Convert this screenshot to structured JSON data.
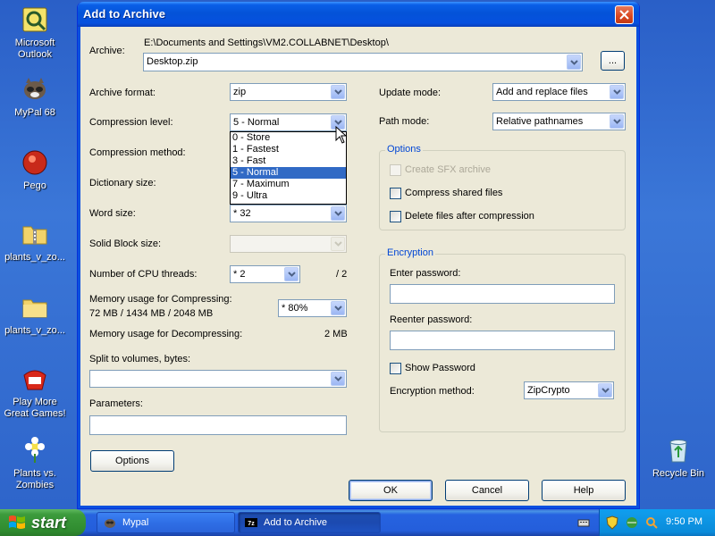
{
  "desktop": {
    "icons": [
      {
        "label": "Microsoft Outlook"
      },
      {
        "label": "MyPal 68"
      },
      {
        "label": "Pego"
      },
      {
        "label": "plants_v_zo..."
      },
      {
        "label": "plants_v_zo..."
      },
      {
        "label": "Play More Great Games!"
      },
      {
        "label": "Plants vs. Zombies"
      },
      {
        "label": "Recycle Bin"
      }
    ]
  },
  "window": {
    "title": "Add to Archive"
  },
  "archive": {
    "label": "Archive:",
    "path": "E:\\Documents and Settings\\VM2.COLLABNET\\Desktop\\",
    "name": "Desktop.zip",
    "browse_label": "..."
  },
  "left": {
    "format_label": "Archive format:",
    "format_value": "zip",
    "level_label": "Compression level:",
    "level_value": "5 - Normal",
    "method_label": "Compression method:",
    "dict_label": "Dictionary size:",
    "word_label": "Word size:",
    "word_value": "* 32",
    "solid_label": "Solid Block size:",
    "threads_label": "Number of CPU threads:",
    "threads_value": "* 2",
    "threads_total": "/ 2",
    "mem_comp_label": "Memory usage for Compressing:",
    "mem_comp_values": "72 MB / 1434 MB / 2048 MB",
    "mem_comp_percent": "* 80%",
    "mem_decomp_label": "Memory usage for Decompressing:",
    "mem_decomp_value": "2 MB",
    "split_label": "Split to volumes, bytes:",
    "params_label": "Parameters:",
    "options_button": "Options"
  },
  "level_dropdown": {
    "options": [
      "0 - Store",
      "1 - Fastest",
      "3 - Fast",
      "5 - Normal",
      "7 - Maximum",
      "9 - Ultra"
    ],
    "selected": "5 - Normal"
  },
  "right": {
    "update_label": "Update mode:",
    "update_value": "Add and replace files",
    "path_label": "Path mode:",
    "path_value": "Relative pathnames",
    "options_group": "Options",
    "sfx_label": "Create SFX archive",
    "shared_label": "Compress shared files",
    "delete_label": "Delete files after compression",
    "encryption_group": "Encryption",
    "enter_pw_label": "Enter password:",
    "reenter_pw_label": "Reenter password:",
    "show_pw_label": "Show Password",
    "enc_method_label": "Encryption method:",
    "enc_method_value": "ZipCrypto"
  },
  "buttons": {
    "ok": "OK",
    "cancel": "Cancel",
    "help": "Help"
  },
  "taskbar": {
    "start_label": "start",
    "tasks": [
      {
        "label": "Mypal"
      },
      {
        "label": "Add to Archive"
      }
    ],
    "clock": "9:50 PM"
  },
  "colors": {
    "accent_blue": "#0a5fe8",
    "selection": "#316ac5",
    "dialog_bg": "#ece9d8",
    "group_legend": "#0046d5"
  }
}
